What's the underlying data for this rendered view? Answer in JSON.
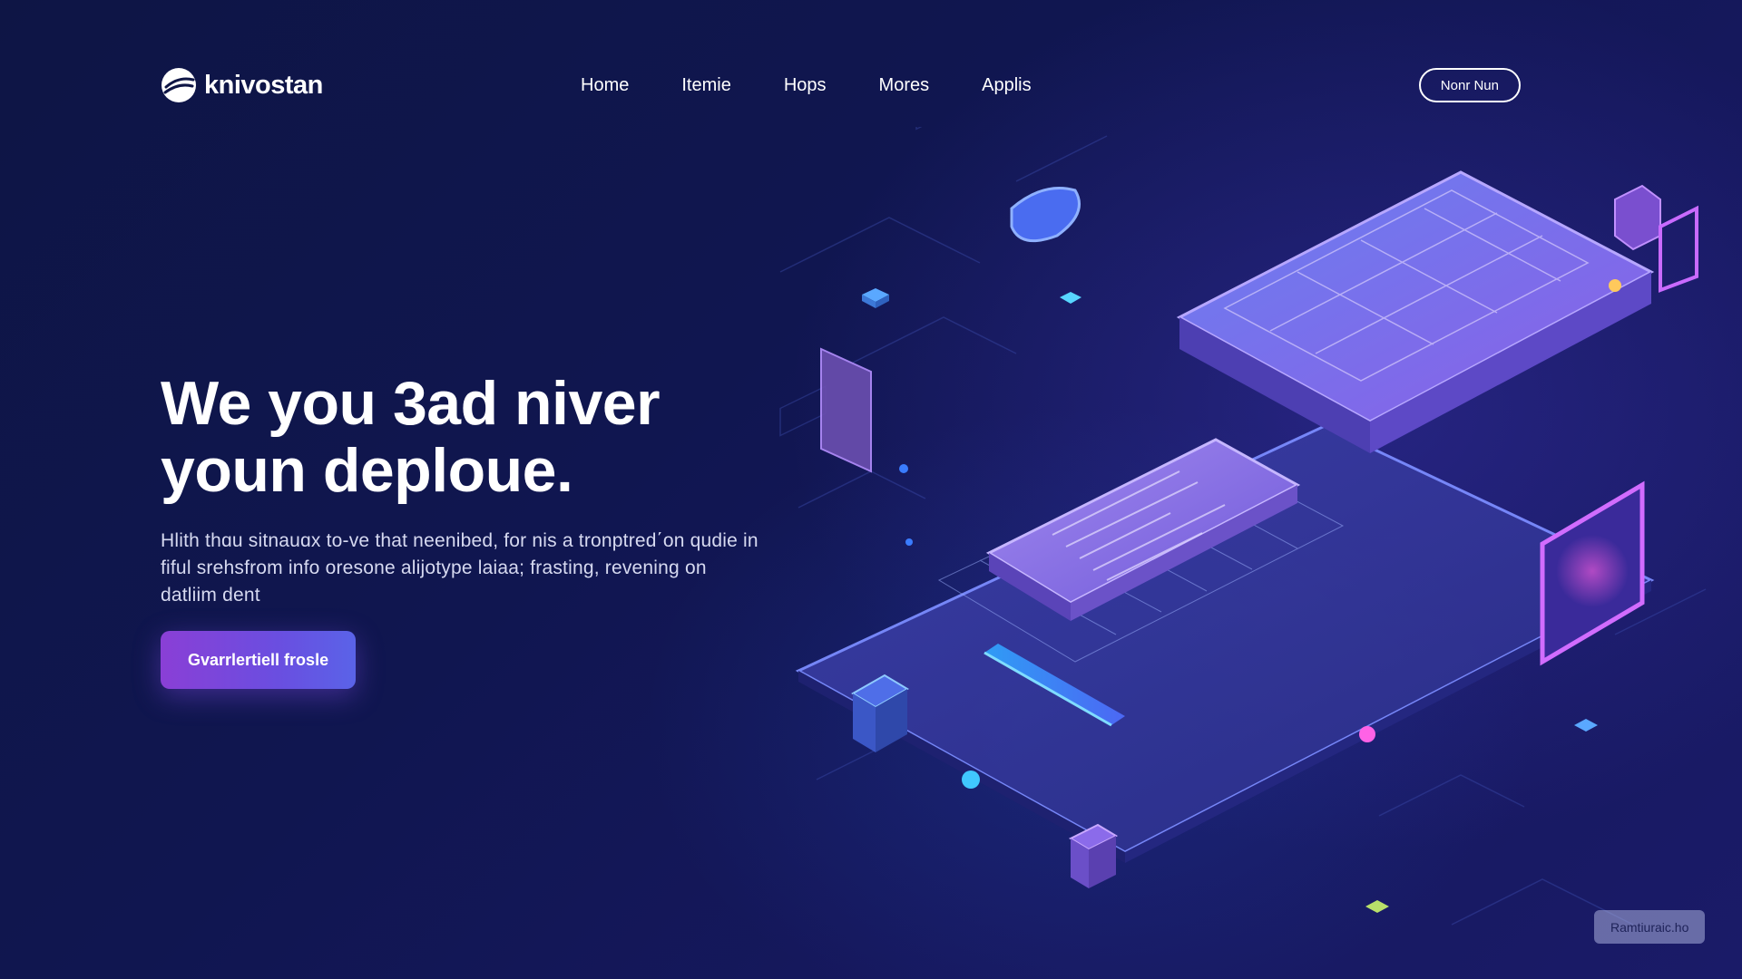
{
  "brand": {
    "name": "knivostan",
    "accent": "#8a3fd6",
    "background": "#0d1140"
  },
  "header": {
    "nav": [
      "Home",
      "Itemie",
      "Hops",
      "Mores",
      "Applis"
    ],
    "button_label": "Nonr Nun"
  },
  "hero": {
    "title": "We you 3ad niver youn deploue.",
    "description": "Hlith thɑu sitnauɑx to-ve that neenibed, for nis a tronptred΄on qudie in fiful srehsfrom info ore͏sone alijotype laiaa; frasting, revening on datliim dent",
    "cta_label": "Gvarrlertiell frosle"
  },
  "corner_chip": {
    "label": "Ramtiuraic.ho"
  },
  "icons": {
    "logo": "swoosh-logo-icon",
    "illustration": "isometric-tech-devices-illustration"
  }
}
